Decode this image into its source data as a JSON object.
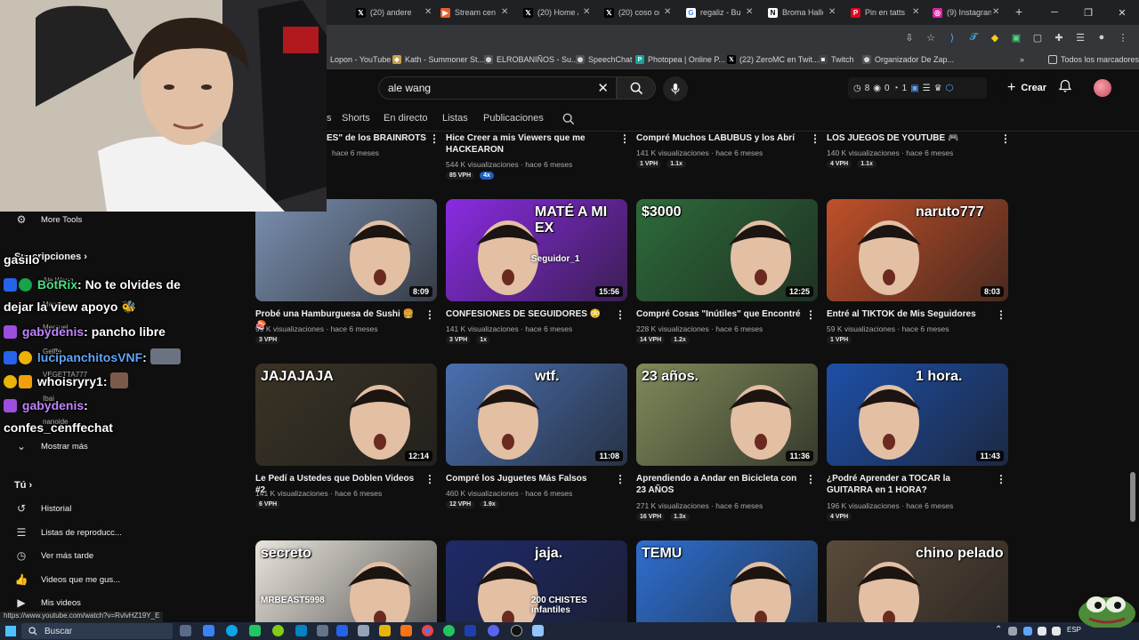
{
  "browser": {
    "tabs": [
      {
        "label": "(20) andere",
        "icon": "x-icon",
        "color": "#000000"
      },
      {
        "label": "Stream cenf",
        "icon": "stream-icon",
        "color": "#e8602c"
      },
      {
        "label": "(20) Home /",
        "icon": "x-icon",
        "color": "#000000"
      },
      {
        "label": "(20) coso or",
        "icon": "x-icon",
        "color": "#000000"
      },
      {
        "label": "regaliz - Bu",
        "icon": "google-icon",
        "color": "#ffffff"
      },
      {
        "label": "Broma Hallo",
        "icon": "notion-icon",
        "color": "#ffffff"
      },
      {
        "label": "Pin en tatts",
        "icon": "pinterest-icon",
        "color": "#e60023"
      },
      {
        "label": "(9) Instagran",
        "icon": "instagram-icon",
        "color": "#d6249f"
      }
    ],
    "new_tab": "+",
    "bookmarks": [
      {
        "label": "Lopon - YouTube",
        "icon": "none"
      },
      {
        "label": "Kath - Summoner St...",
        "icon": "game-icon"
      },
      {
        "label": "ELROBANIÑOS - Su...",
        "icon": "globe-icon"
      },
      {
        "label": "SpeechChat",
        "icon": "globe-icon"
      },
      {
        "label": "Photopea | Online P...",
        "icon": "photopea-icon"
      },
      {
        "label": "(22) ZeroMC en Twit...",
        "icon": "x-icon"
      },
      {
        "label": "Twitch",
        "icon": "twitch-icon"
      },
      {
        "label": "Organizador De Zap...",
        "icon": "globe-icon"
      }
    ],
    "bookmarks_more": "»",
    "all_bookmarks": "Todos los marcadores",
    "status_url": "https://www.youtube.com/watch?v=RvlvHZ19Y_E"
  },
  "youtube": {
    "search": {
      "value": "ale wang"
    },
    "ext_stats": {
      "a": "8",
      "b": "0",
      "c": "1"
    },
    "create_label": "Crear",
    "chips": [
      "Shorts",
      "En directo",
      "Listas",
      "Publicaciones"
    ],
    "top_row": [
      {
        "title": "ES\" de los BRAINROTS",
        "meta": "hace 6 meses"
      },
      {
        "title": "Hice Creer a mis Viewers que me HACKEARON",
        "meta": "544 K visualizaciones · hace 6 meses",
        "vph": "85 VPH",
        "ratio": "4x"
      },
      {
        "title": "Compré Muchos LABUBUS y los Abrí",
        "meta": "141 K visualizaciones · hace 6 meses",
        "vph": "1 VPH",
        "ratio": "1.1x"
      },
      {
        "title": "LOS JUEGOS DE YOUTUBE 🎮",
        "meta": "140 K visualizaciones · hace 6 meses",
        "vph": "4 VPH",
        "ratio": "1.1x"
      }
    ],
    "videos": [
      {
        "title": "Probé una Hamburguesa de Sushi 🍔🍣",
        "meta": "99 K visualizaciones · hace 6 meses",
        "vph": "3 VPH",
        "ratio": "",
        "duration": "8:09",
        "thumb_text": "",
        "bg": "#7a8fb0"
      },
      {
        "title": "CONFESIONES DE SEGUIDORES 😳",
        "meta": "141 K visualizaciones · hace 6 meses",
        "vph": "3 VPH",
        "ratio": "1x",
        "duration": "15:56",
        "thumb_text": "MATÉ A MI EX",
        "thumb_sub": "Seguidor_1",
        "bg": "#8a2be2"
      },
      {
        "title": "Compré Cosas \"Inútiles\" que Encontré",
        "meta": "228 K visualizaciones · hace 6 meses",
        "vph": "14 VPH",
        "ratio": "1.2x",
        "duration": "12:25",
        "thumb_text": "$3000",
        "bg": "#2d6b3a"
      },
      {
        "title": "Entré al TIKTOK de Mis Seguidores",
        "meta": "59 K visualizaciones · hace 6 meses",
        "vph": "1 VPH",
        "ratio": "",
        "duration": "8:03",
        "thumb_text": "naruto777",
        "bg": "#c0502a"
      },
      {
        "title": "Le Pedí a Ustedes que Doblen Videos #2",
        "meta": "141 K visualizaciones · hace 6 meses",
        "vph": "6 VPH",
        "ratio": "",
        "duration": "12:14",
        "thumb_text": "JAJAJAJA",
        "bg": "#3a3325"
      },
      {
        "title": "Compré los Juguetes Más Falsos",
        "meta": "460 K visualizaciones · hace 6 meses",
        "vph": "12 VPH",
        "ratio": "1.9x",
        "duration": "11:08",
        "thumb_text": "wtf.",
        "bg": "#4a6fb0"
      },
      {
        "title": "Aprendiendo a Andar en Bicicleta con 23 AÑOS",
        "meta": "271 K visualizaciones · hace 6 meses",
        "vph": "16 VPH",
        "ratio": "1.3x",
        "duration": "11:36",
        "thumb_text": "23 años.",
        "bg": "#7f8a5a"
      },
      {
        "title": "¿Podré Aprender a TOCAR la GUITARRA en 1 HORA?",
        "meta": "196 K visualizaciones · hace 6 meses",
        "vph": "4 VPH",
        "ratio": "",
        "duration": "11:43",
        "thumb_text": "1 hora.",
        "bg": "#1e4fa8"
      },
      {
        "title": "",
        "meta": "",
        "vph": "",
        "ratio": "",
        "duration": "",
        "thumb_text": "secreto",
        "thumb_sub": "MRBEAST5998",
        "bg": "#e9e4dc"
      },
      {
        "title": "",
        "meta": "",
        "vph": "",
        "ratio": "",
        "duration": "",
        "thumb_text": "jaja.",
        "thumb_sub": "200 CHISTES infantiles",
        "bg": "#1e2a6a"
      },
      {
        "title": "",
        "meta": "",
        "vph": "",
        "ratio": "",
        "duration": "",
        "thumb_text": "TEMU",
        "bg": "#2e6fd0"
      },
      {
        "title": "",
        "meta": "",
        "vph": "",
        "ratio": "",
        "duration": "",
        "thumb_text": "chino pelado",
        "bg": "#5a4a3a"
      }
    ]
  },
  "sidebar": {
    "more_tools": "More Tools",
    "subscriptions": "Suscripciones",
    "subs_items": [
      "Ale Wang",
      "Mewd",
      "Mercuel",
      "Gelffe",
      "VEGETTA777",
      "Ibai",
      "nanoide"
    ],
    "show_more": "Mostrar más",
    "you": "Tú",
    "you_items": [
      "Historial",
      "Listas de reproducc...",
      "Ver más tarde",
      "Videos que me gus...",
      "Mis videos"
    ]
  },
  "chat": [
    {
      "user": "gasilo",
      "msg": "",
      "color": "#ffffff"
    },
    {
      "user": "BotRix",
      "msg": ": No te olvides de",
      "color": "#4ade80"
    },
    {
      "user": "",
      "msg": "dejar la view apoyo 🐝",
      "color": "#ffffff"
    },
    {
      "user": "gabydenis",
      "msg": ": pancho libre",
      "color": "#c084fc"
    },
    {
      "user": "lucipanchitosVNF",
      "msg": ":",
      "color": "#60a5fa"
    },
    {
      "user": "whoisryry1",
      "msg": ":",
      "color": "#ffffff"
    },
    {
      "user": "gabydenis",
      "msg": ":",
      "color": "#c084fc"
    },
    {
      "user": "",
      "msg": "confes_cenffechat",
      "color": "#ffffff"
    }
  ],
  "taskbar": {
    "search_label": "Buscar",
    "lang": "ESP"
  }
}
